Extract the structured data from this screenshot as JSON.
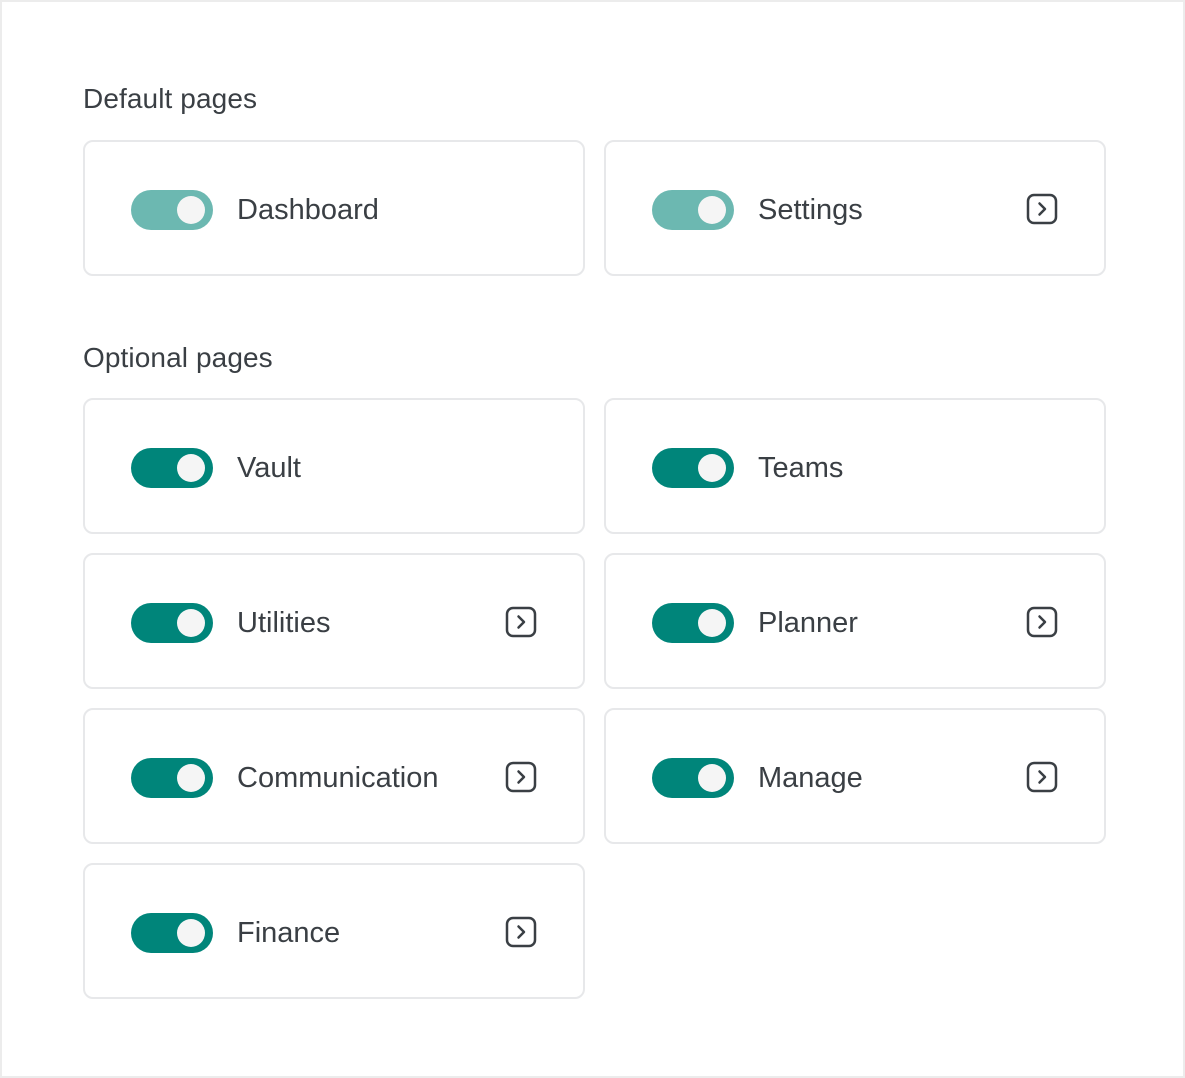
{
  "sections": {
    "default": {
      "title": "Default pages",
      "items": [
        {
          "label": "Dashboard",
          "enabled": true,
          "locked": true,
          "has_link": false
        },
        {
          "label": "Settings",
          "enabled": true,
          "locked": true,
          "has_link": true
        }
      ]
    },
    "optional": {
      "title": "Optional pages",
      "items": [
        {
          "label": "Vault",
          "enabled": true,
          "has_link": false
        },
        {
          "label": "Teams",
          "enabled": true,
          "has_link": false
        },
        {
          "label": "Utilities",
          "enabled": true,
          "has_link": true
        },
        {
          "label": "Planner",
          "enabled": true,
          "has_link": true
        },
        {
          "label": "Communication",
          "enabled": true,
          "has_link": true
        },
        {
          "label": "Manage",
          "enabled": true,
          "has_link": true
        },
        {
          "label": "Finance",
          "enabled": true,
          "has_link": true
        }
      ]
    }
  },
  "colors": {
    "toggle_on": "#00857a",
    "toggle_on_locked": "#6cb8b1",
    "border": "#e7e8ea",
    "text": "#3a3f44"
  },
  "icons": {
    "toggle": "toggle-switch",
    "link": "chevron-right-square-icon"
  }
}
